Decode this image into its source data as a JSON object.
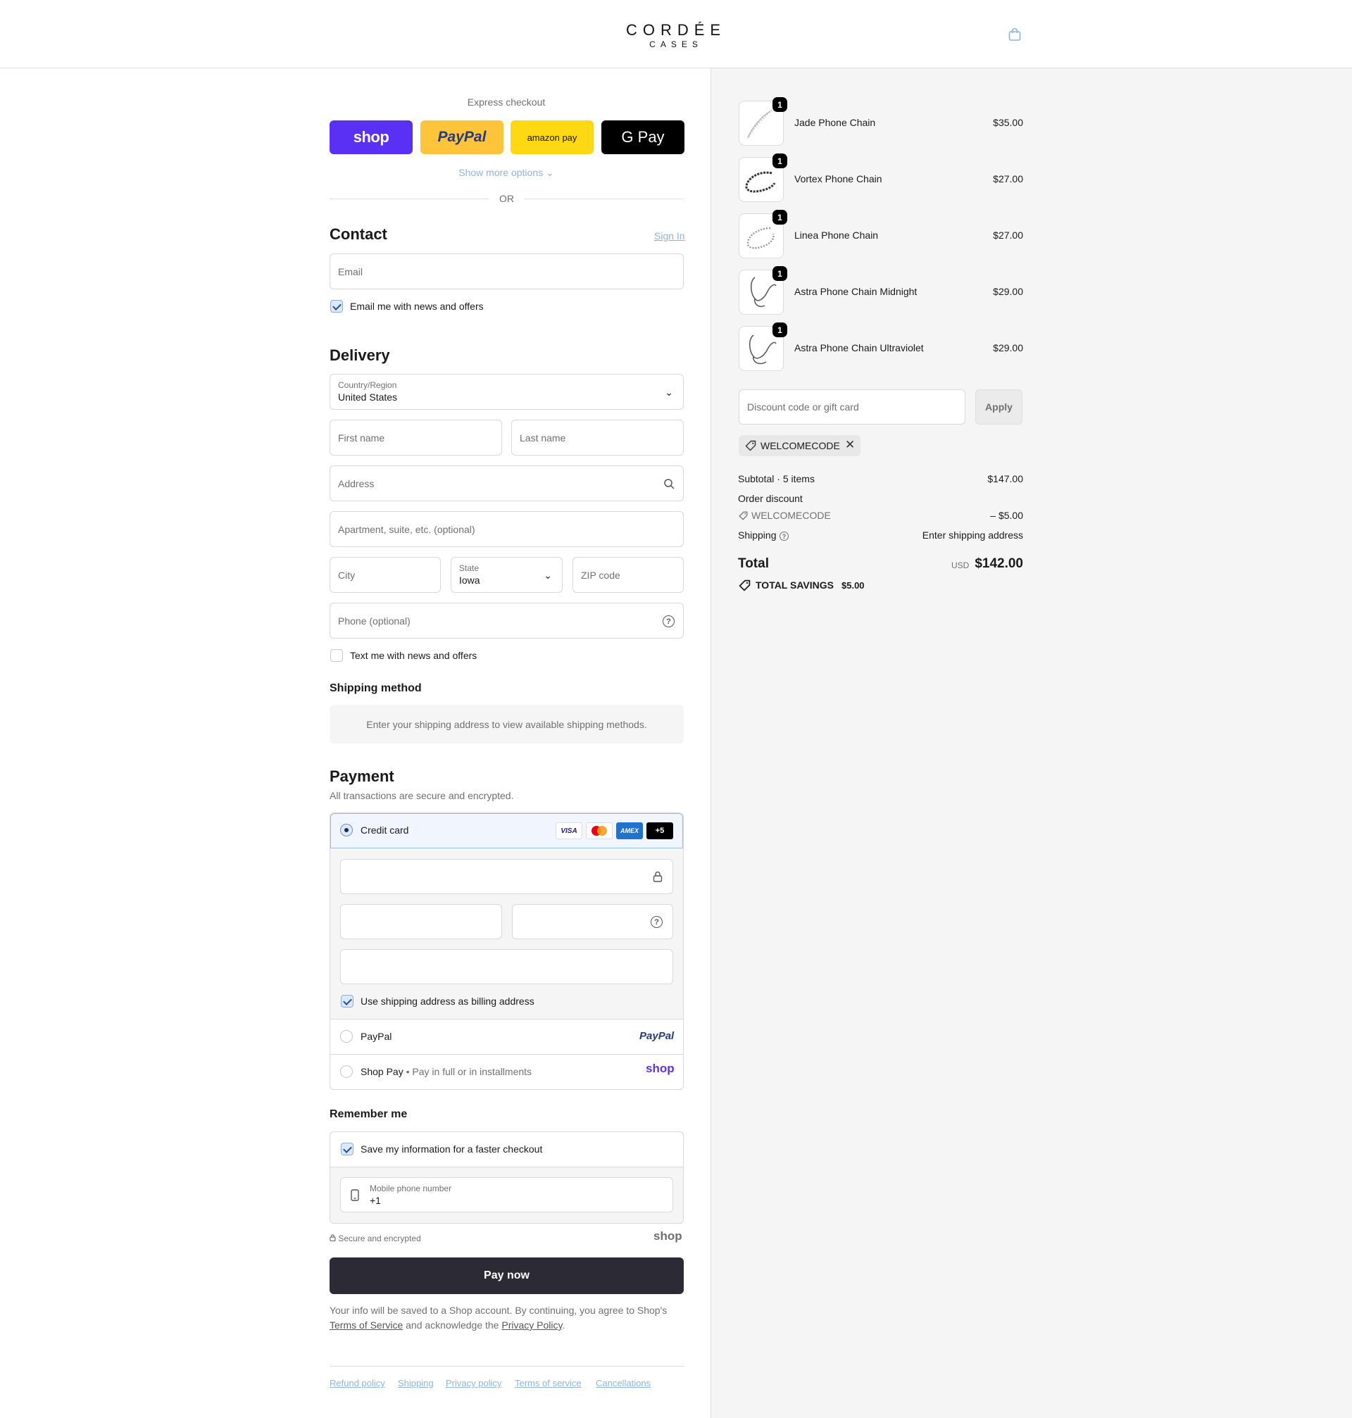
{
  "brand": {
    "name": "CORDÉE",
    "sub": "CASES"
  },
  "express": {
    "title": "Express checkout",
    "shop_label": "shop",
    "paypal_label": "PayPal",
    "amazon_label": "amazon pay",
    "gpay_label": "G Pay",
    "more_options": "Show more options",
    "or": "OR"
  },
  "contact": {
    "title": "Contact",
    "sign_in": "Sign In",
    "email_placeholder": "Email",
    "news_label": "Email me with news and offers"
  },
  "delivery": {
    "title": "Delivery",
    "country_label": "Country/Region",
    "country_value": "United States",
    "first_name": "First name",
    "last_name": "Last name",
    "address": "Address",
    "apartment": "Apartment, suite, etc. (optional)",
    "city": "City",
    "state_label": "State",
    "state_value": "Iowa",
    "zip": "ZIP code",
    "phone": "Phone (optional)",
    "text_label": "Text me with news and offers"
  },
  "shipping_method": {
    "title": "Shipping method",
    "message": "Enter your shipping address to view available shipping methods."
  },
  "payment": {
    "title": "Payment",
    "subtitle": "All transactions are secure and encrypted.",
    "credit_card": "Credit card",
    "visa": "VISA",
    "amex": "AMEX",
    "more_cards": "+5",
    "billing_label": "Use shipping address as billing address",
    "paypal": "PayPal",
    "paypal_logo": "PayPal",
    "shop_pay": "Shop Pay",
    "shop_pay_sub": "Pay in full or in installments",
    "shop_logo": "shop"
  },
  "remember": {
    "title": "Remember me",
    "save_label": "Save my information for a faster checkout",
    "mobile_label": "Mobile phone number",
    "mobile_value": "+1",
    "secure": "Secure and encrypted",
    "shop_logo": "shop"
  },
  "pay_button": "Pay now",
  "legal": {
    "text1": "Your info will be saved to a Shop account. By continuing, you agree to Shop's",
    "tos": "Terms of Service",
    "and": "and acknowledge the",
    "privacy": "Privacy Policy",
    "period": "."
  },
  "footer_links": [
    "Refund policy",
    "Shipping",
    "Privacy policy",
    "Terms of service",
    "Cancellations"
  ],
  "order": {
    "items": [
      {
        "name": "Jade Phone Chain",
        "price": "$35.00",
        "qty": "1"
      },
      {
        "name": "Vortex Phone Chain",
        "price": "$27.00",
        "qty": "1"
      },
      {
        "name": "Linea Phone Chain",
        "price": "$27.00",
        "qty": "1"
      },
      {
        "name": "Astra Phone Chain Midnight",
        "price": "$29.00",
        "qty": "1"
      },
      {
        "name": "Astra Phone Chain Ultraviolet",
        "price": "$29.00",
        "qty": "1"
      }
    ],
    "discount_placeholder": "Discount code or gift card",
    "apply": "Apply",
    "applied_code": "WELCOMECODE",
    "subtotal_label": "Subtotal · 5 items",
    "subtotal_value": "$147.00",
    "order_discount": "Order discount",
    "discount_code": "WELCOMECODE",
    "discount_value": "– $5.00",
    "shipping_label": "Shipping",
    "shipping_value": "Enter shipping address",
    "total_label": "Total",
    "currency": "USD",
    "total_value": "$142.00",
    "savings_label": "TOTAL SAVINGS",
    "savings_value": "$5.00"
  },
  "colors": {
    "shop_purple": "#5a31f4",
    "paypal_yellow": "#ffc439",
    "amazon_yellow": "#ffd814",
    "pay_button": "#2b2a35"
  }
}
